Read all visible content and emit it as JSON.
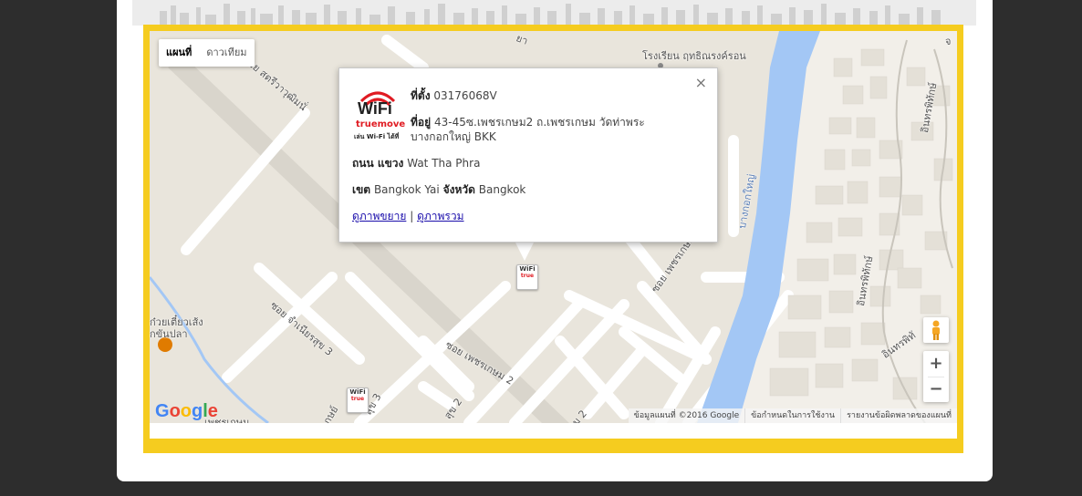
{
  "map": {
    "type_map_label": "แผนที่",
    "type_satellite_label": "ดาวเทียม",
    "attribution": {
      "data": "ข้อมูลแผนที่ ©2016 Google",
      "terms": "ข้อกำหนดในการใช้งาน",
      "report": "รายงานข้อผิดพลาดของแผนที่"
    },
    "zoom_in": "+",
    "zoom_out": "−",
    "google_logo": [
      "G",
      "o",
      "o",
      "g",
      "l",
      "e"
    ],
    "place_labels": {
      "school": "โรงเรียน ฤทธิณรงค์รอน",
      "road_top_left": "ซอย สตรีวาวุฒิมนั่",
      "road_top": "ยา",
      "road_left_mid": "ซอย จำเนียรสุข 3",
      "restaurant": "ก๋วยเตี๋ยวเส้ง",
      "restaurant2": "กขันปลา",
      "road_bottom_1": "สุข 3",
      "road_bottom_2": "สุข 2",
      "road_bottom_3": "ซอย เพชรเกษม 2",
      "road_right": "ซอย เพชรเกษม 2",
      "road_bottom_right": "ม 2",
      "river": "บางกอกใหญ่",
      "road_east_1": "อินทรพิทักษ์",
      "road_east_2": "อินทรพิทักษ์",
      "road_east_3": "อินทรพิทั",
      "road_bottom_far": "เพชรเกษม",
      "road_bottom_left": "กษย์",
      "road_east_top": "จ"
    }
  },
  "popup": {
    "location_label": "ที่ตั้ง",
    "location_value": "03176068V",
    "address_label": "ที่อยู่",
    "address_value": "43-45ซ.เพชรเกษม2 ถ.เพชรเกษม วัดท่าพระ",
    "address_value2": "บางกอกใหญ่ BKK",
    "road_label": "ถนน แขวง",
    "road_value": "Wat Tha Phra",
    "district_label": "เขต",
    "district_value": "Bangkok Yai",
    "province_label": "จังหวัด",
    "province_value": "Bangkok",
    "link_zoom": "ดูภาพขยาย",
    "separator": "|",
    "link_overview": "ดูภาพรวม",
    "close": "×",
    "logo_wifi": "WiFi",
    "logo_brand": "truemove",
    "logo_tag": "เล่น Wi-Fi ได้ที่"
  },
  "marker": {
    "text": "WiFi",
    "brand": "true"
  },
  "colors": {
    "frame": "#f5cc1f",
    "river": "#a3c7f5",
    "road": "#ffffff",
    "land": "#e9e5dc"
  }
}
